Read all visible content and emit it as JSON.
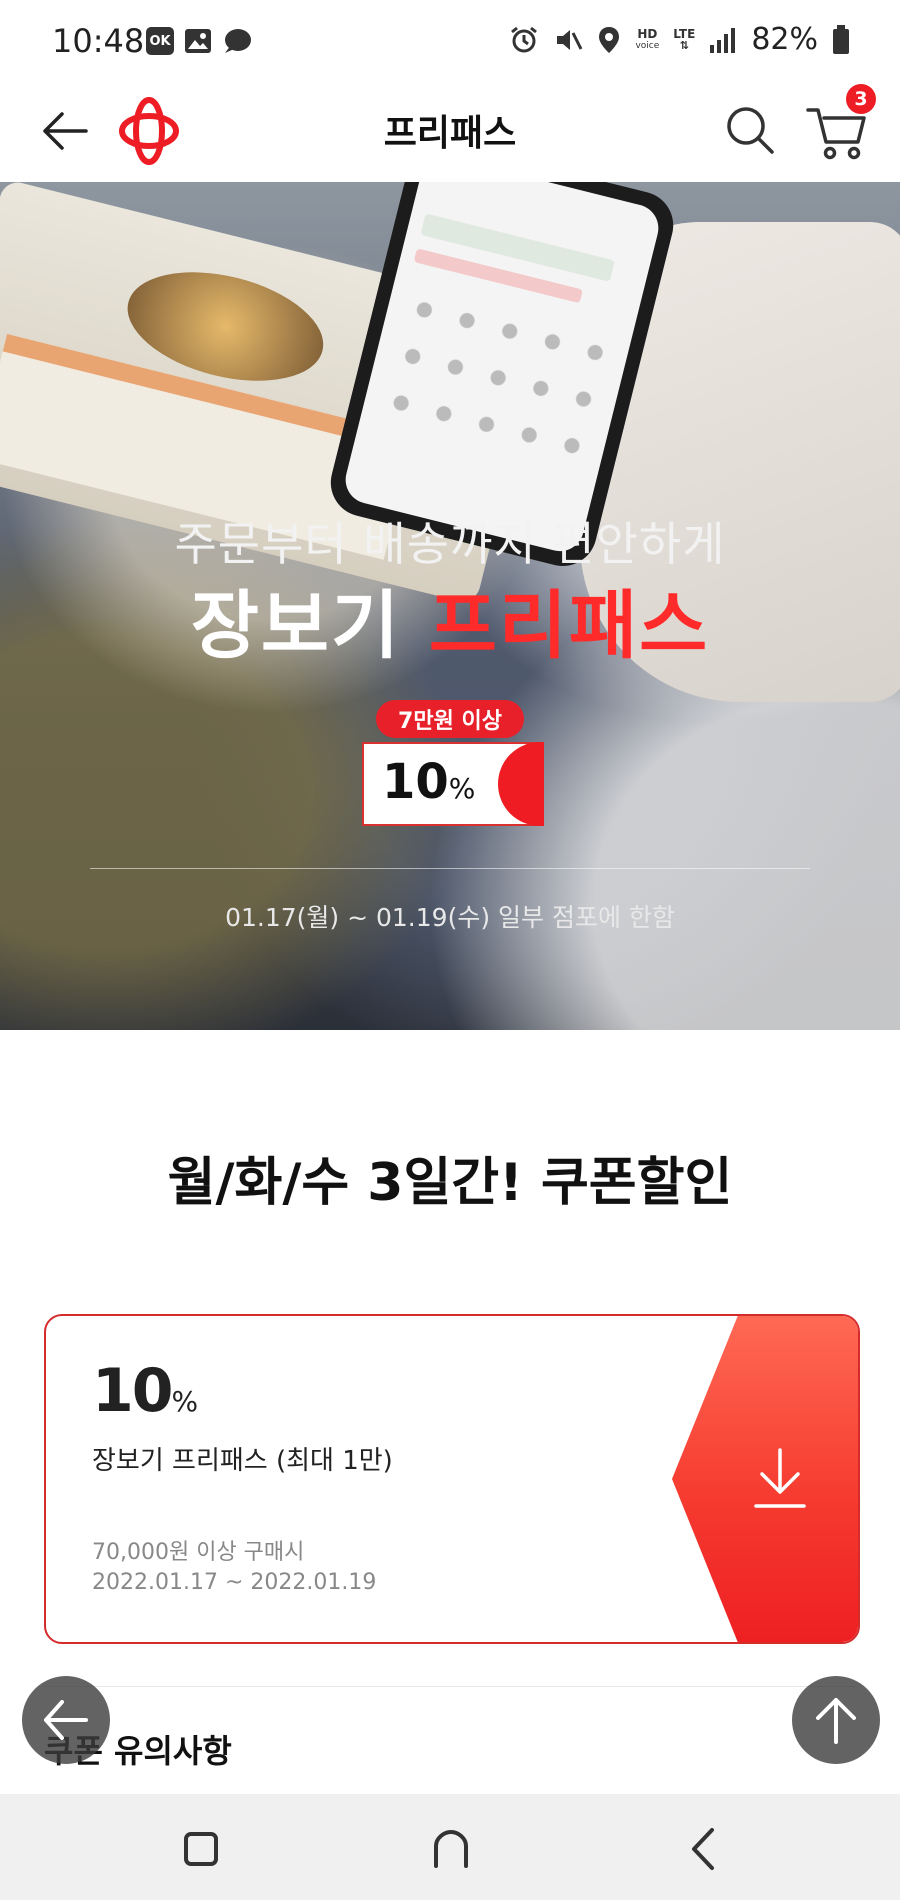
{
  "status_bar": {
    "time": "10:48",
    "left_icons": [
      "ok-cashbag-icon",
      "image-icon",
      "chat-icon"
    ],
    "hd_top": "HD",
    "hd_bottom": "voice",
    "lte": "LTE",
    "battery_text": "82%"
  },
  "header": {
    "title": "프리패스",
    "cart_count": "3",
    "brand_color": "#ee1c25"
  },
  "hero": {
    "subtitle": "주문부터 배송까지 편안하게",
    "title_white": "장보기",
    "title_red": "프리패스",
    "condition": "7만원 이상",
    "discount_value": "10",
    "discount_unit": "%",
    "period": "01.17(월) ~ 01.19(수) 일부 점포에 한함"
  },
  "section": {
    "title": "월/화/수 3일간! 쿠폰할인"
  },
  "coupon": {
    "value": "10",
    "unit": "%",
    "name": "장보기 프리패스 (최대 1만)",
    "condition": "70,000원 이상 구매시",
    "date_range": "2022.01.17 ~ 2022.01.19",
    "download_icon": "download-icon"
  },
  "notice": {
    "title": "쿠폰 유의사항"
  },
  "colors": {
    "accent_red": "#ee1c25",
    "nav_bg": "#f0f0f0"
  }
}
